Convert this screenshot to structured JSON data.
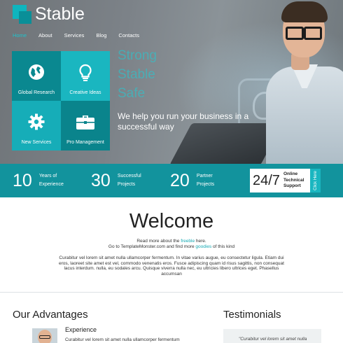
{
  "header": {
    "brand": "Stable",
    "nav": [
      "Home",
      "About",
      "Services",
      "Blog",
      "Contacts"
    ],
    "active_nav": "Home"
  },
  "hero": {
    "tiles": [
      {
        "label": "Global Research",
        "icon": "globe-icon"
      },
      {
        "label": "Creative Ideas",
        "icon": "lightbulb-icon"
      },
      {
        "label": "New Services",
        "icon": "gear-icon"
      },
      {
        "label": "Pro Management",
        "icon": "briefcase-icon"
      }
    ],
    "faded_lines": [
      "Strong",
      "Stable",
      "Safe"
    ],
    "tagline": "We help you run your business in a successful way"
  },
  "stats": [
    {
      "number": "10",
      "label_line1": "Years of",
      "label_line2": "Experience"
    },
    {
      "number": "30",
      "label_line1": "Successful",
      "label_line2": "Projects"
    },
    {
      "number": "20",
      "label_line1": "Partner",
      "label_line2": "Projects"
    }
  ],
  "support": {
    "number": "24/7",
    "label_line1": "Online",
    "label_line2": "Technical",
    "label_line3": "Support",
    "cta": "Click Here"
  },
  "welcome": {
    "title": "Welcome",
    "line1_pre": "Read more about the ",
    "line1_link": "freeble",
    "line1_post": " here.",
    "line2_pre": "Go to TemplateMonster.com and find more ",
    "line2_link": "goodies",
    "line2_post": " of this kind",
    "body": "Curabitur vel lorem sit amet nulla ullamcorper fermentum. In vitae varius augue, eu consectetur ligula. Etiam dui eros, laoreet site amet est vel, commodo venenatis eros. Fusce adipiscing quam id risus sagittis, non consequat lacus interdum. nulla, eu sodales arcu. Quisque viverra nulla nec, eu ultricies libero ultrices eget. Phasellus accumsan"
  },
  "advantages": {
    "title": "Our Advantages",
    "item_heading": "Experience",
    "item_text": "Curabitur vel lorem sit amet nulla ullamcorper fermentum"
  },
  "testimonials": {
    "title": "Testimonials",
    "quote": "\"Curabitur vel lorem sit amet nulla"
  },
  "colors": {
    "accent": "#1ab6c0",
    "dark_teal": "#0a8890",
    "stats_bar": "#12939d"
  }
}
